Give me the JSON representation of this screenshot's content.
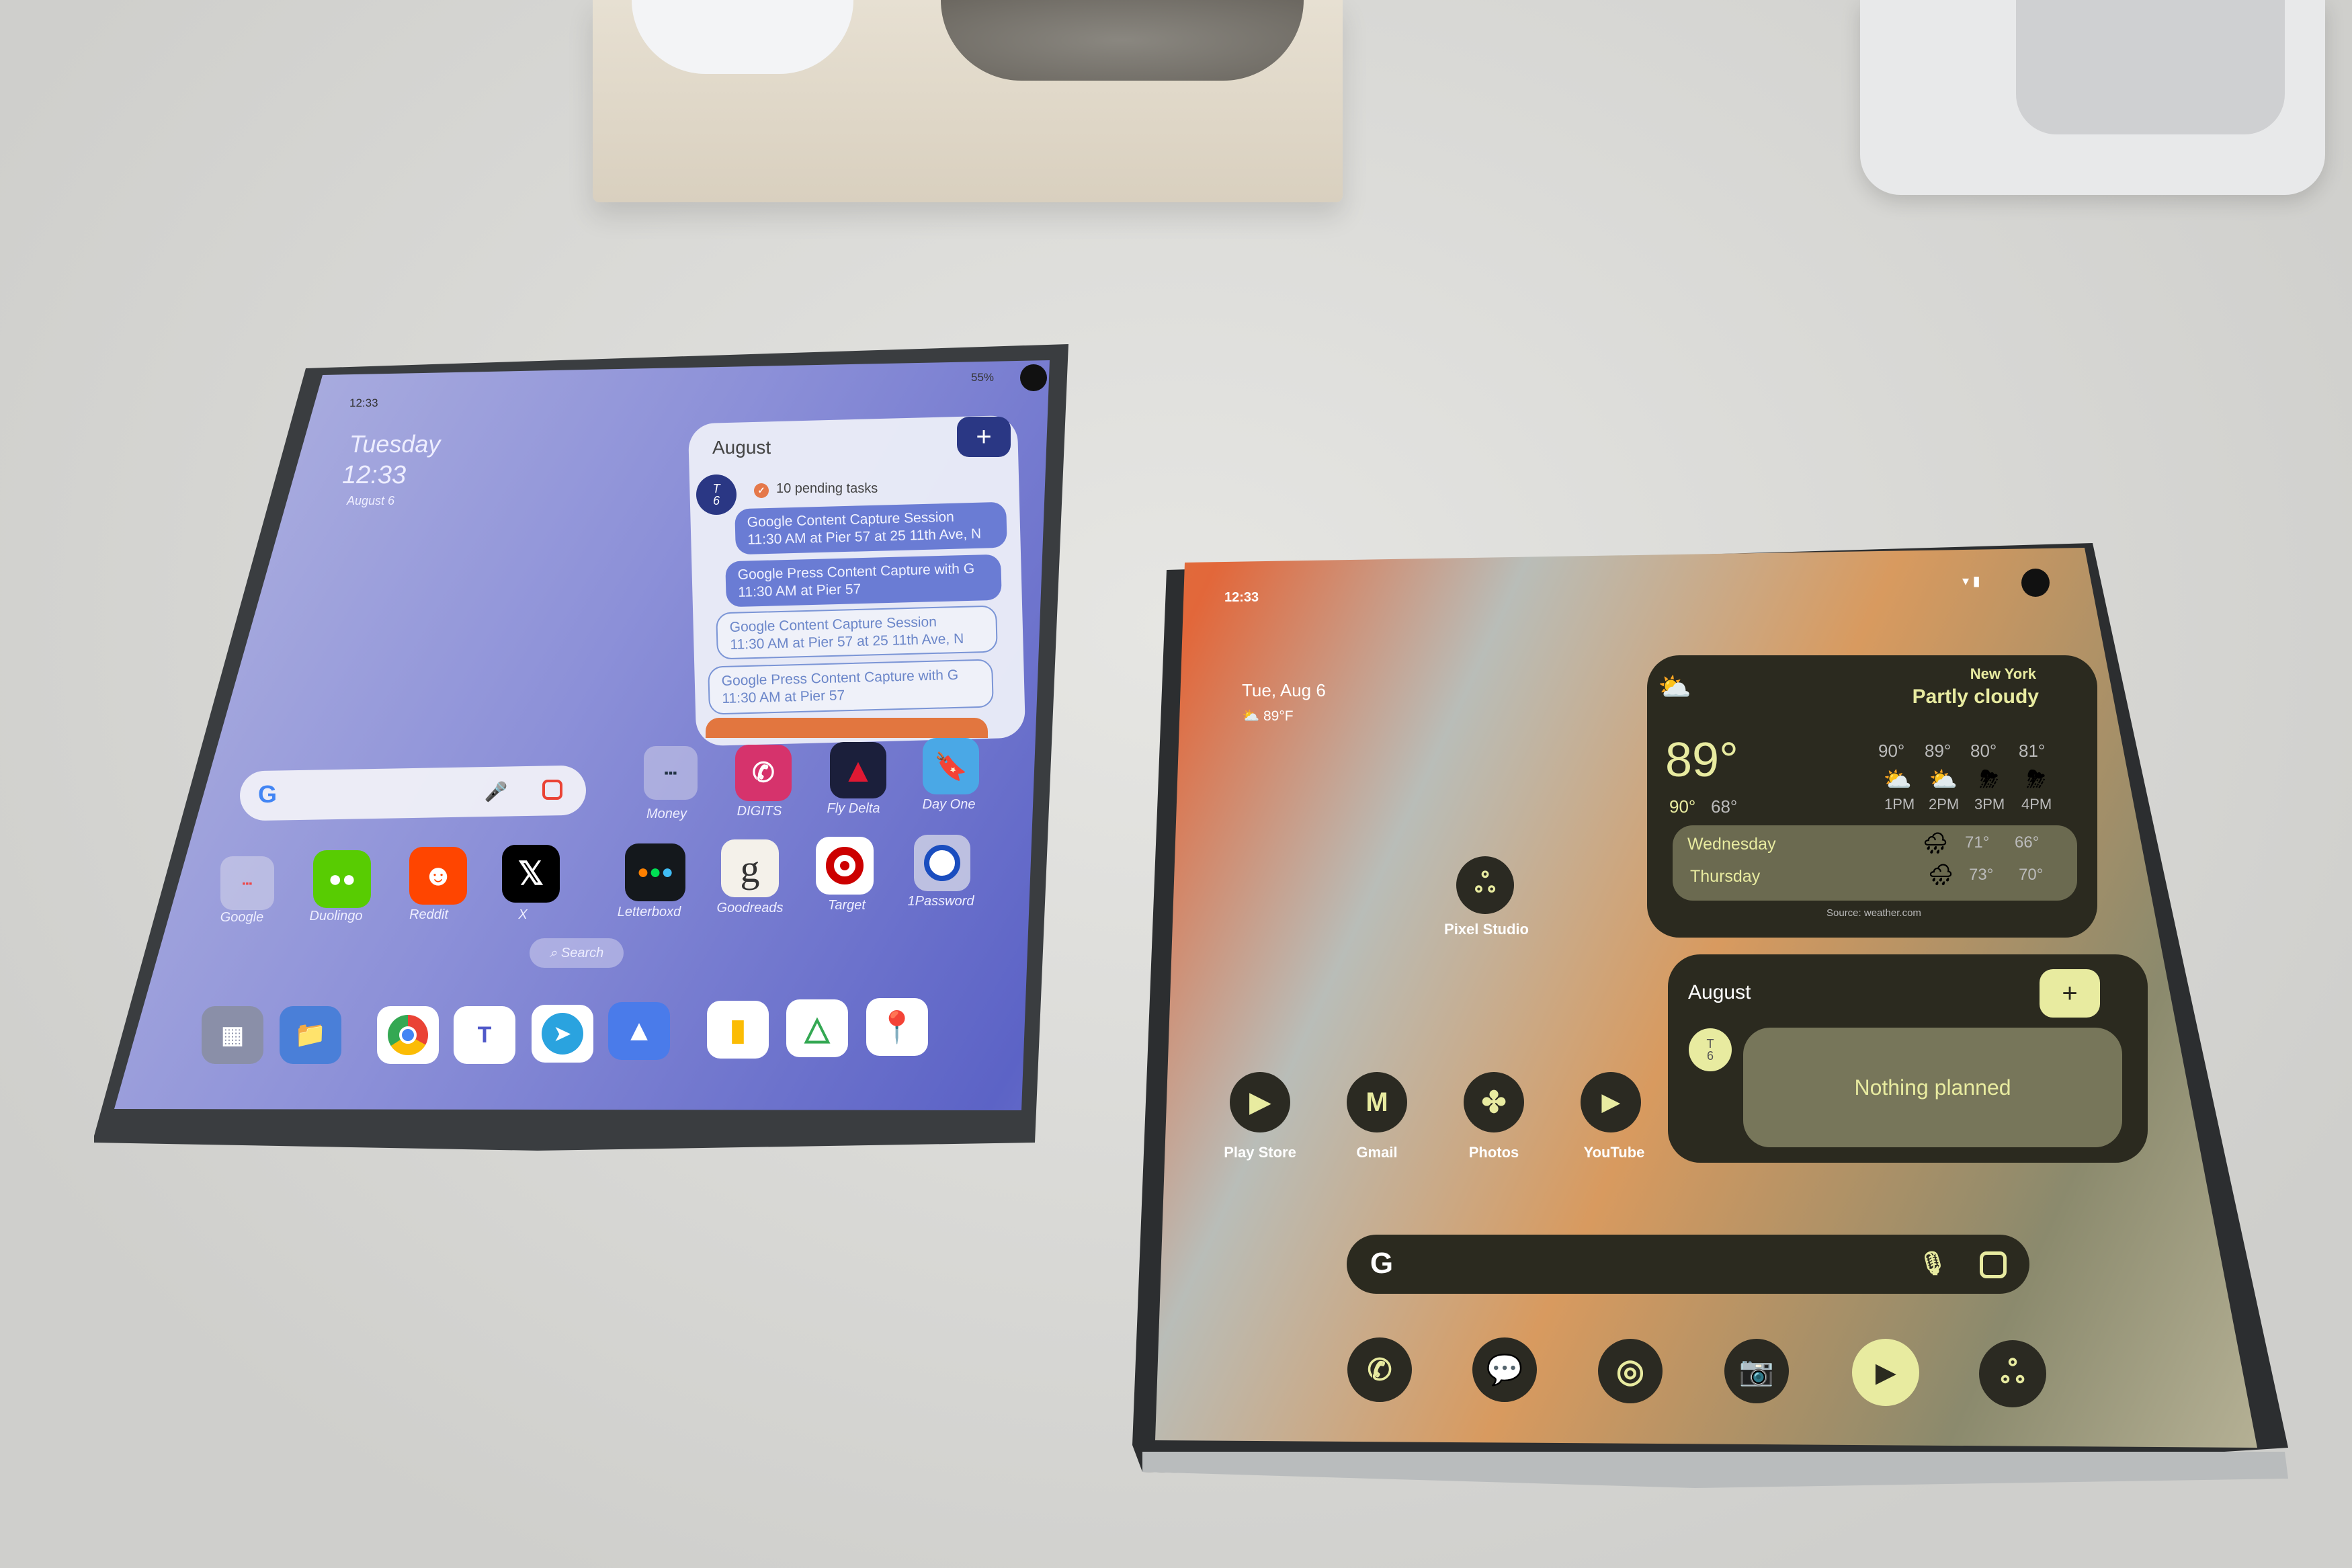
{
  "left_phone": {
    "status": {
      "time": "12:33",
      "battery": "55%"
    },
    "clock": {
      "day": "Tuesday",
      "time": "12:33",
      "date": "August 6"
    },
    "calendar": {
      "month": "August",
      "add_label": "+",
      "day_letter": "T",
      "day_number": "6",
      "pending": "10 pending tasks",
      "events": [
        {
          "title": "Google Content Capture Session",
          "detail": "11:30 AM at Pier 57 at 25 11th Ave, N",
          "style": "filled"
        },
        {
          "title": "Google Press Content Capture with G",
          "detail": "11:30 AM at Pier 57",
          "style": "filled"
        },
        {
          "title": "Google Content Capture Session",
          "detail": "11:30 AM at Pier 57 at 25 11th Ave, N",
          "style": "outline"
        },
        {
          "title": "Google Press Content Capture with G",
          "detail": "11:30 AM at Pier 57",
          "style": "outline"
        }
      ]
    },
    "search_bar": {
      "logo": "G"
    },
    "apps": [
      "Money",
      "DIGITS",
      "Fly Delta",
      "Day One",
      "Google",
      "Duolingo",
      "Reddit",
      "X",
      "Letterboxd",
      "Goodreads",
      "Target",
      "1Password"
    ],
    "search_pill": "Search",
    "dock": [
      "app-drawer-icon",
      "files-icon",
      "chrome-icon",
      "teams-icon",
      "telegram-icon",
      "spark-icon",
      "keep-icon",
      "drive-icon",
      "maps-icon"
    ],
    "wallpaper_color": "#7f86d6"
  },
  "right_phone": {
    "status": {
      "time": "12:33"
    },
    "at_a_glance": {
      "date": "Tue, Aug 6",
      "temp": "89°F"
    },
    "pixel_studio_label": "Pixel Studio",
    "weather": {
      "city": "New York",
      "condition": "Partly cloudy",
      "current": "89°",
      "high": "90°",
      "low": "68°",
      "hourly": [
        {
          "temp": "90°",
          "time": "1PM",
          "icon": "partly-cloudy-icon"
        },
        {
          "temp": "89°",
          "time": "2PM",
          "icon": "partly-cloudy-icon"
        },
        {
          "temp": "80°",
          "time": "3PM",
          "icon": "thunderstorm-icon"
        },
        {
          "temp": "81°",
          "time": "4PM",
          "icon": "thunderstorm-icon"
        }
      ],
      "daily": [
        {
          "day": "Wednesday",
          "high": "71°",
          "low": "66°",
          "icon": "rain-icon"
        },
        {
          "day": "Thursday",
          "high": "73°",
          "low": "70°",
          "icon": "rain-icon"
        }
      ],
      "source": "Source: weather.com"
    },
    "calendar": {
      "month": "August",
      "add_label": "+",
      "day_letter": "T",
      "day_number": "6",
      "empty": "Nothing planned"
    },
    "apps": [
      "Play Store",
      "Gmail",
      "Photos",
      "YouTube"
    ],
    "search_bar": {
      "logo": "G"
    },
    "dock": [
      "phone-icon",
      "messages-icon",
      "chrome-icon",
      "camera-icon",
      "youtube-icon",
      "pixel-studio-icon"
    ],
    "accent_color": "#e8eba0",
    "widget_color": "#2b2a1f"
  }
}
